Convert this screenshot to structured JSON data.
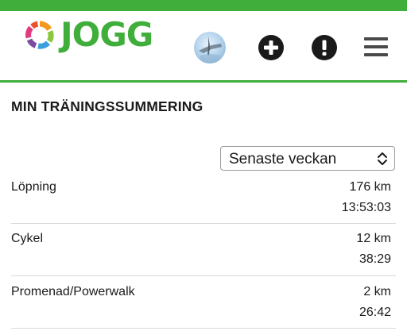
{
  "header": {
    "logo_text": "JOGG",
    "add_icon": "plus-circle-icon",
    "alert_icon": "exclamation-circle-icon",
    "menu_icon": "hamburger-menu-icon",
    "colors": {
      "brand_green": "#3fae3a",
      "icon_dark": "#1a1a1a"
    }
  },
  "summary": {
    "title": "MIN TRÄNINGSSUMMERING",
    "period_select": {
      "value": "Senaste veckan"
    },
    "activities": [
      {
        "name": "Löpning",
        "distance": "176 km",
        "time": "13:53:03"
      },
      {
        "name": "Cykel",
        "distance": "12 km",
        "time": "38:29"
      },
      {
        "name": "Promenad/Powerwalk",
        "distance": "2 km",
        "time": "26:42"
      }
    ]
  }
}
